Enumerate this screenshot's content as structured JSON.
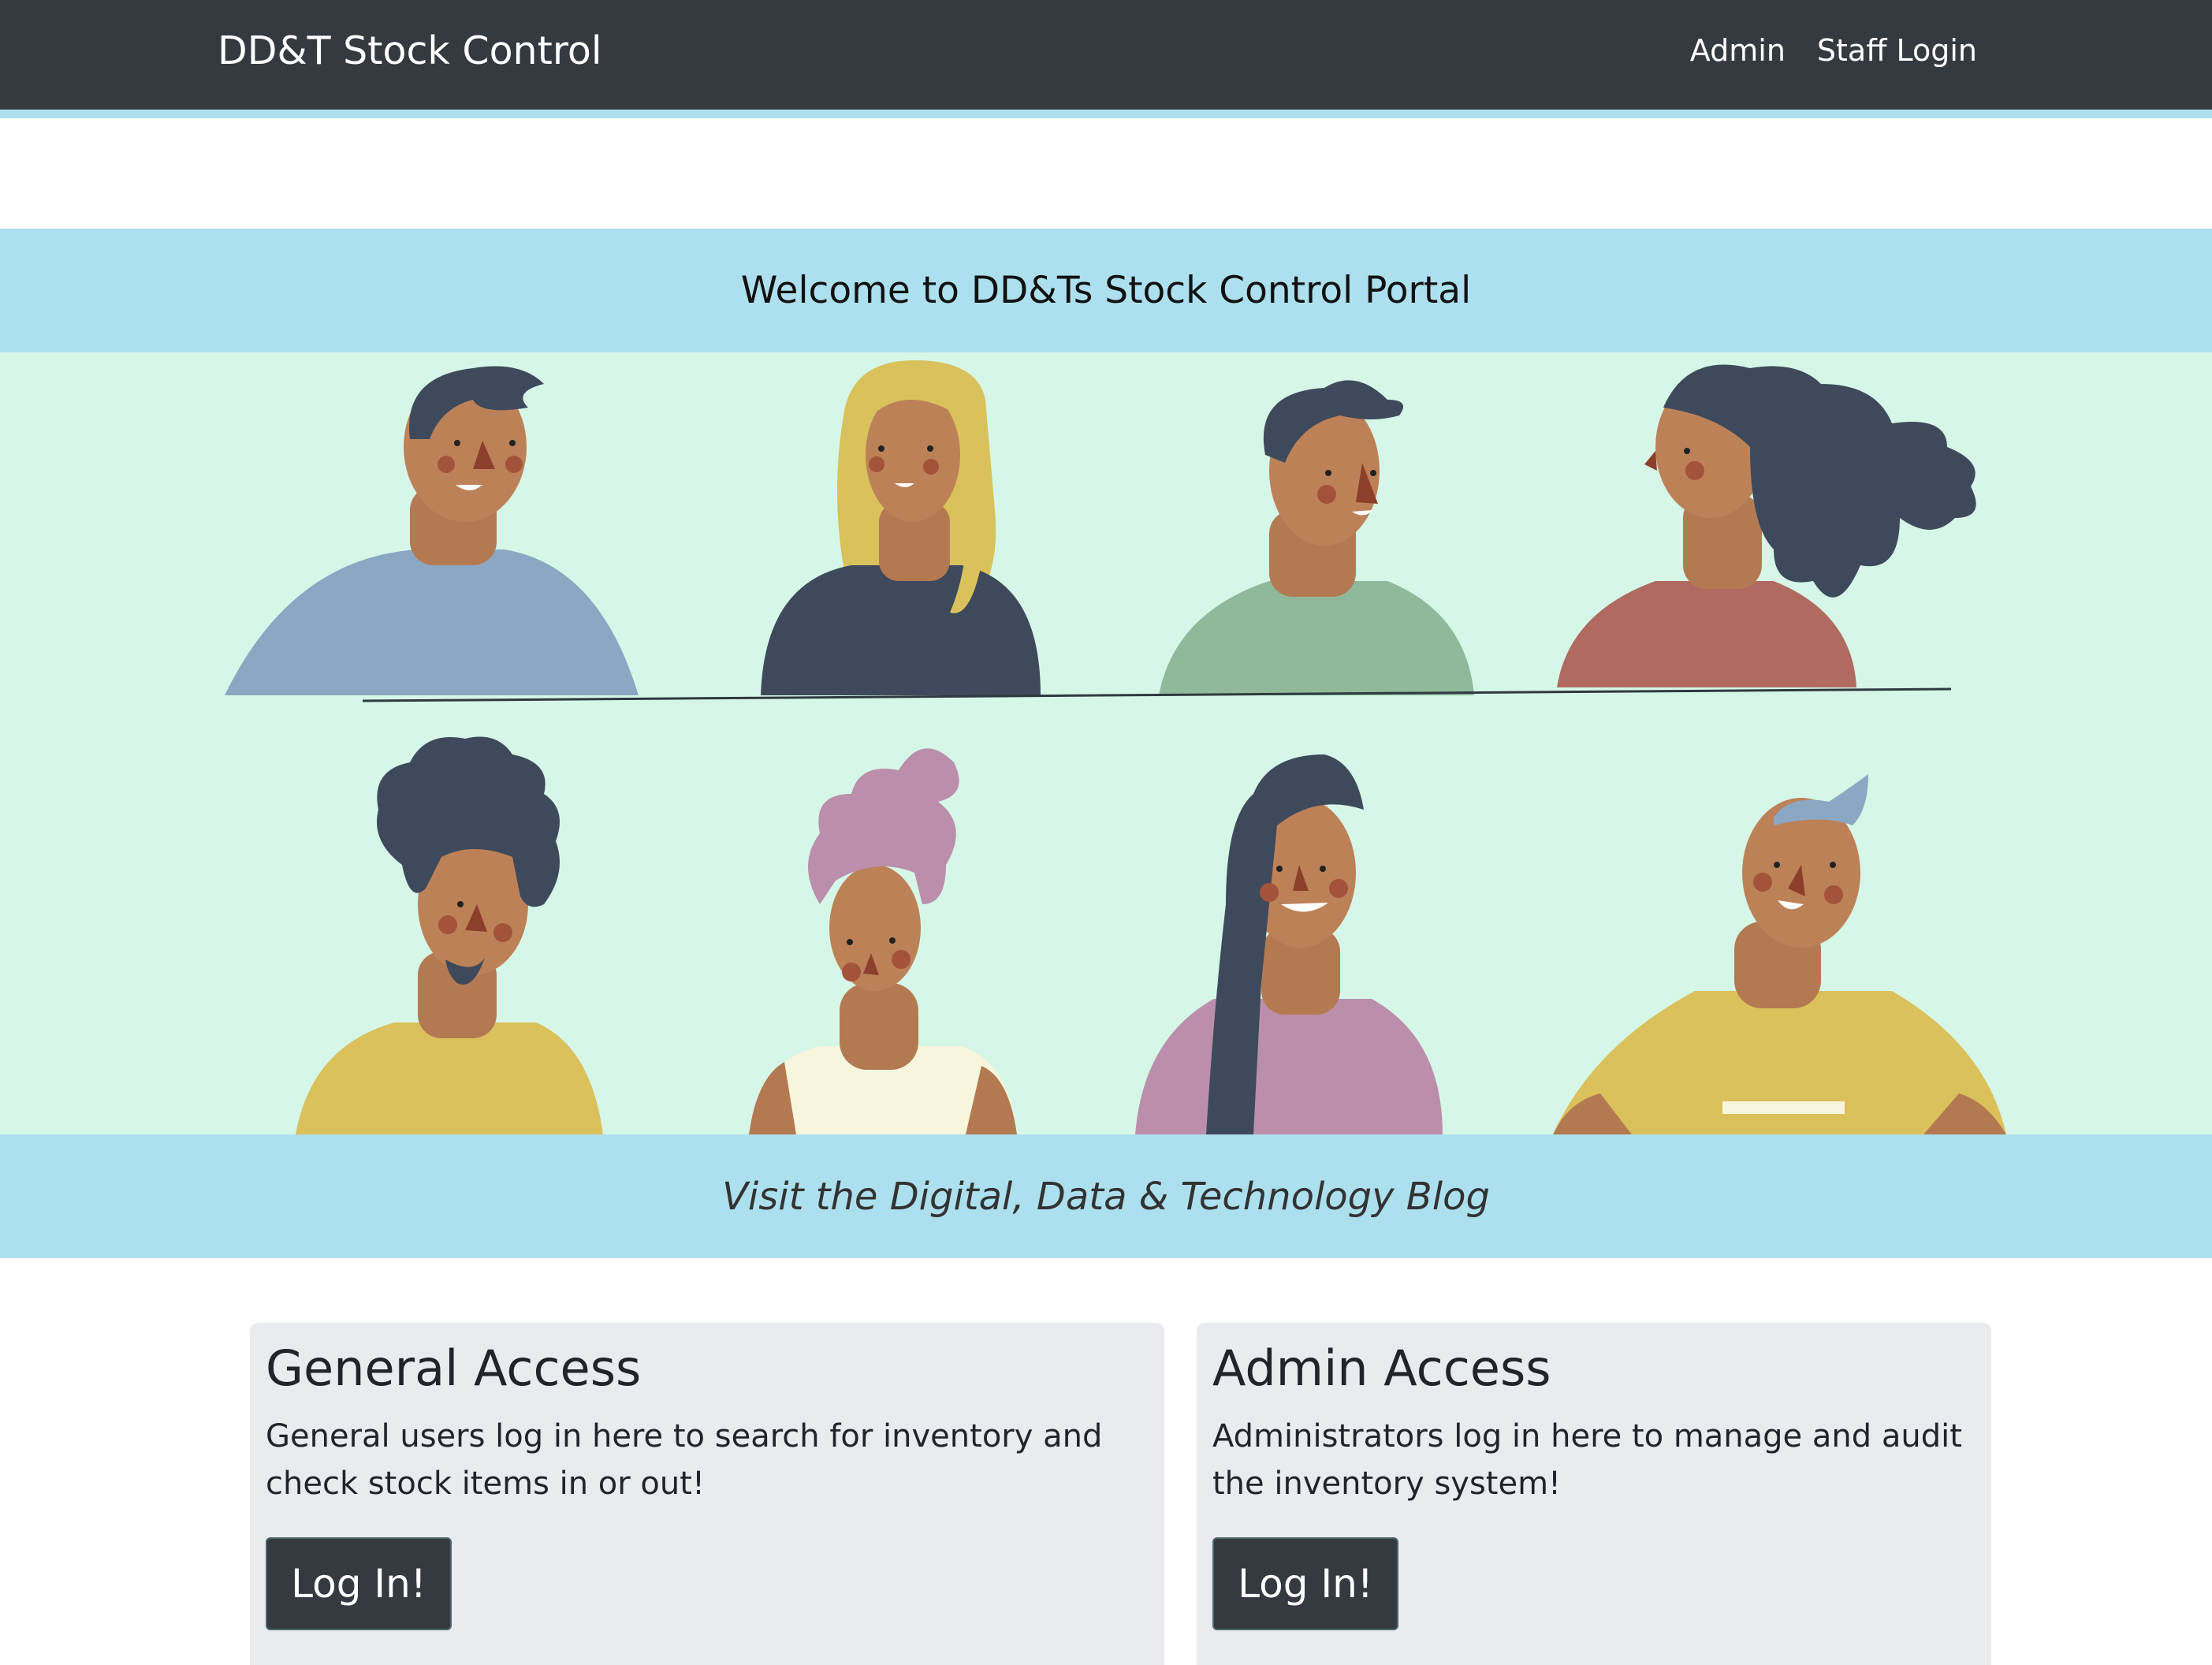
{
  "navbar": {
    "brand": "DD&T Stock Control",
    "links": [
      "Admin",
      "Staff Login"
    ]
  },
  "hero": {
    "welcome_title": "Welcome to DD&Ts Stock Control Portal",
    "blog_link": "Visit the Digital, Data & Technology Blog"
  },
  "cards": [
    {
      "title": "General Access",
      "text": "General users log in here to search for inventory and check stock items in or out!",
      "button": "Log In!"
    },
    {
      "title": "Admin Access",
      "text": "Administrators log in here to manage and audit the inventory system!",
      "button": "Log In!"
    }
  ],
  "colors": {
    "navbar_bg": "#343a40",
    "band_bg": "#ade0ee",
    "hero_bg": "#d6f7e8",
    "card_bg": "#e9ebef",
    "button_bg": "#343a40"
  }
}
